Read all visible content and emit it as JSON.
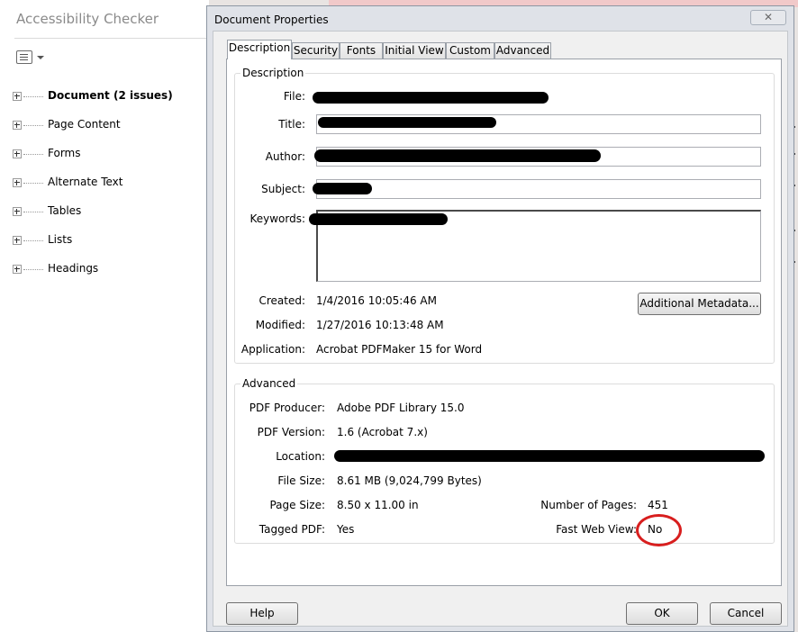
{
  "accessibility_checker": {
    "title": "Accessibility Checker",
    "items": [
      {
        "label": "Document (2 issues)"
      },
      {
        "label": "Page Content"
      },
      {
        "label": "Forms"
      },
      {
        "label": "Alternate Text"
      },
      {
        "label": "Tables"
      },
      {
        "label": "Lists"
      },
      {
        "label": "Headings"
      }
    ]
  },
  "dialog": {
    "title": "Document Properties",
    "close_icon": "close-icon",
    "tabs": [
      {
        "label": "Description"
      },
      {
        "label": "Security"
      },
      {
        "label": "Fonts"
      },
      {
        "label": "Initial View"
      },
      {
        "label": "Custom"
      },
      {
        "label": "Advanced"
      }
    ],
    "active_tab": "Description",
    "description": {
      "group_title": "Description",
      "file_label": "File:",
      "title_label": "Title:",
      "author_label": "Author:",
      "subject_label": "Subject:",
      "keywords_label": "Keywords:",
      "created_label": "Created:",
      "created_value": "1/4/2016 10:05:46 AM",
      "modified_label": "Modified:",
      "modified_value": "1/27/2016 10:13:48 AM",
      "application_label": "Application:",
      "application_value": "Acrobat PDFMaker 15 for Word",
      "additional_metadata_button": "Additional Metadata..."
    },
    "advanced": {
      "group_title": "Advanced",
      "pdf_producer_label": "PDF Producer:",
      "pdf_producer_value": "Adobe PDF Library 15.0",
      "pdf_version_label": "PDF Version:",
      "pdf_version_value": "1.6 (Acrobat 7.x)",
      "location_label": "Location:",
      "file_size_label": "File Size:",
      "file_size_value": "8.61 MB (9,024,799 Bytes)",
      "page_size_label": "Page Size:",
      "page_size_value": "8.50 x 11.00 in",
      "number_of_pages_label": "Number of Pages:",
      "number_of_pages_value": "451",
      "tagged_pdf_label": "Tagged PDF:",
      "tagged_pdf_value": "Yes",
      "fast_web_view_label": "Fast Web View:",
      "fast_web_view_value": "No"
    },
    "buttons": {
      "help": "Help",
      "ok": "OK",
      "cancel": "Cancel"
    }
  },
  "colors": {
    "highlight_circle": "#d81e1e",
    "dialog_frame": "#dfe2e8"
  }
}
